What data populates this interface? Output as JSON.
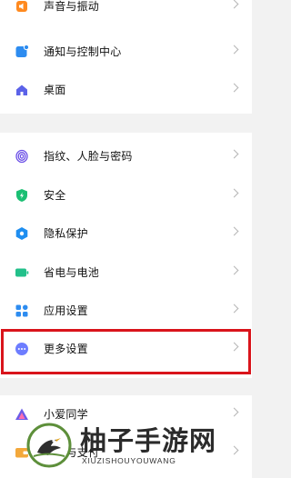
{
  "settings": {
    "group1": [
      {
        "label": "声音与振动",
        "icon": "speaker-icon",
        "color": "#ff8a1f"
      },
      {
        "label": "通知与控制中心",
        "icon": "notification-icon",
        "color": "#2d8cf0"
      },
      {
        "label": "桌面",
        "icon": "home-icon",
        "color": "#5b62e8"
      }
    ],
    "group2": [
      {
        "label": "指纹、人脸与密码",
        "icon": "fingerprint-icon",
        "color": "#6a4ee6"
      },
      {
        "label": "安全",
        "icon": "shield-icon",
        "color": "#1bbf73"
      },
      {
        "label": "隐私保护",
        "icon": "privacy-icon",
        "color": "#1e8ef0"
      },
      {
        "label": "省电与电池",
        "icon": "battery-icon",
        "color": "#22c08a"
      },
      {
        "label": "应用设置",
        "icon": "apps-icon",
        "color": "#2d8cf0"
      },
      {
        "label": "更多设置",
        "icon": "more-dots-icon",
        "color": "#6d7dff"
      }
    ],
    "group3": [
      {
        "label": "小爱同学",
        "icon": "xiaoai-icon",
        "color": "#6c5ce7"
      },
      {
        "label": "钱包与支付",
        "icon": "wallet-icon",
        "color": "#f3a83b"
      }
    ]
  },
  "highlight_color": "#d9141b",
  "watermark": {
    "title": "柚子手游网",
    "subtitle": "XIUZISHOUYOUWANG"
  }
}
